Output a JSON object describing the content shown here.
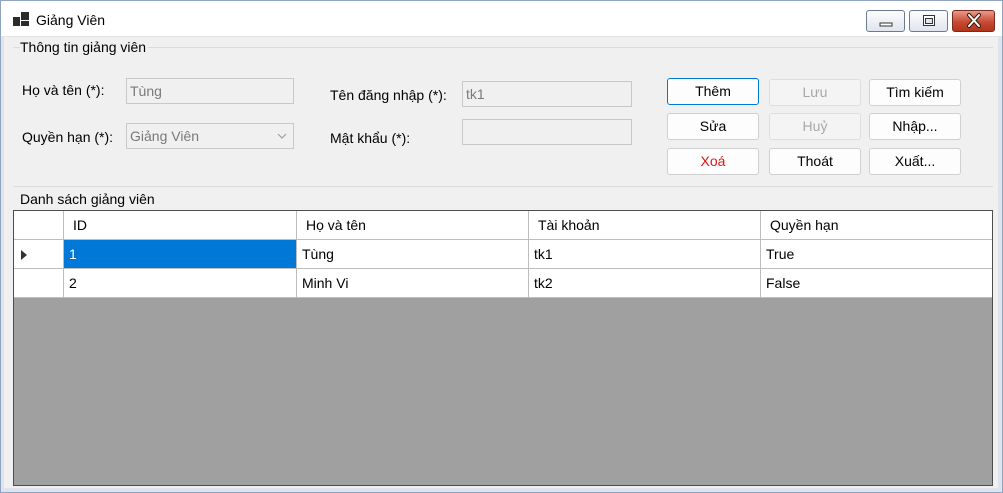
{
  "window": {
    "title": "Giảng Viên",
    "icons": {
      "app": "app-icon",
      "minimize": "minimize-icon",
      "maximize": "maximize-icon",
      "close": "close-icon"
    }
  },
  "info_group": {
    "title": "Thông tin giảng viên",
    "fullname_label": "Họ và tên (*):",
    "fullname_value": "Tùng",
    "role_label": "Quyền hạn (*):",
    "role_value": "Giảng Viên",
    "username_label": "Tên đăng nhập (*):",
    "username_value": "tk1",
    "password_label": "Mật khẩu (*):",
    "password_value": ""
  },
  "buttons": {
    "add": "Thêm",
    "save": "Lưu",
    "search": "Tìm kiếm",
    "edit": "Sửa",
    "cancel": "Huỷ",
    "import": "Nhập...",
    "delete": "Xoá",
    "exit": "Thoát",
    "export": "Xuất..."
  },
  "list_group": {
    "title": "Danh sách giảng viên",
    "columns": [
      "ID",
      "Họ và tên",
      "Tài khoản",
      "Quyền hạn"
    ],
    "rows": [
      [
        "1",
        "Tùng",
        "tk1",
        "True"
      ],
      [
        "2",
        "Minh Vi",
        "tk2",
        "False"
      ]
    ]
  },
  "colors": {
    "accent": "#0078d7",
    "delete_text": "#e11414",
    "grid_background": "#a0a0a0"
  }
}
